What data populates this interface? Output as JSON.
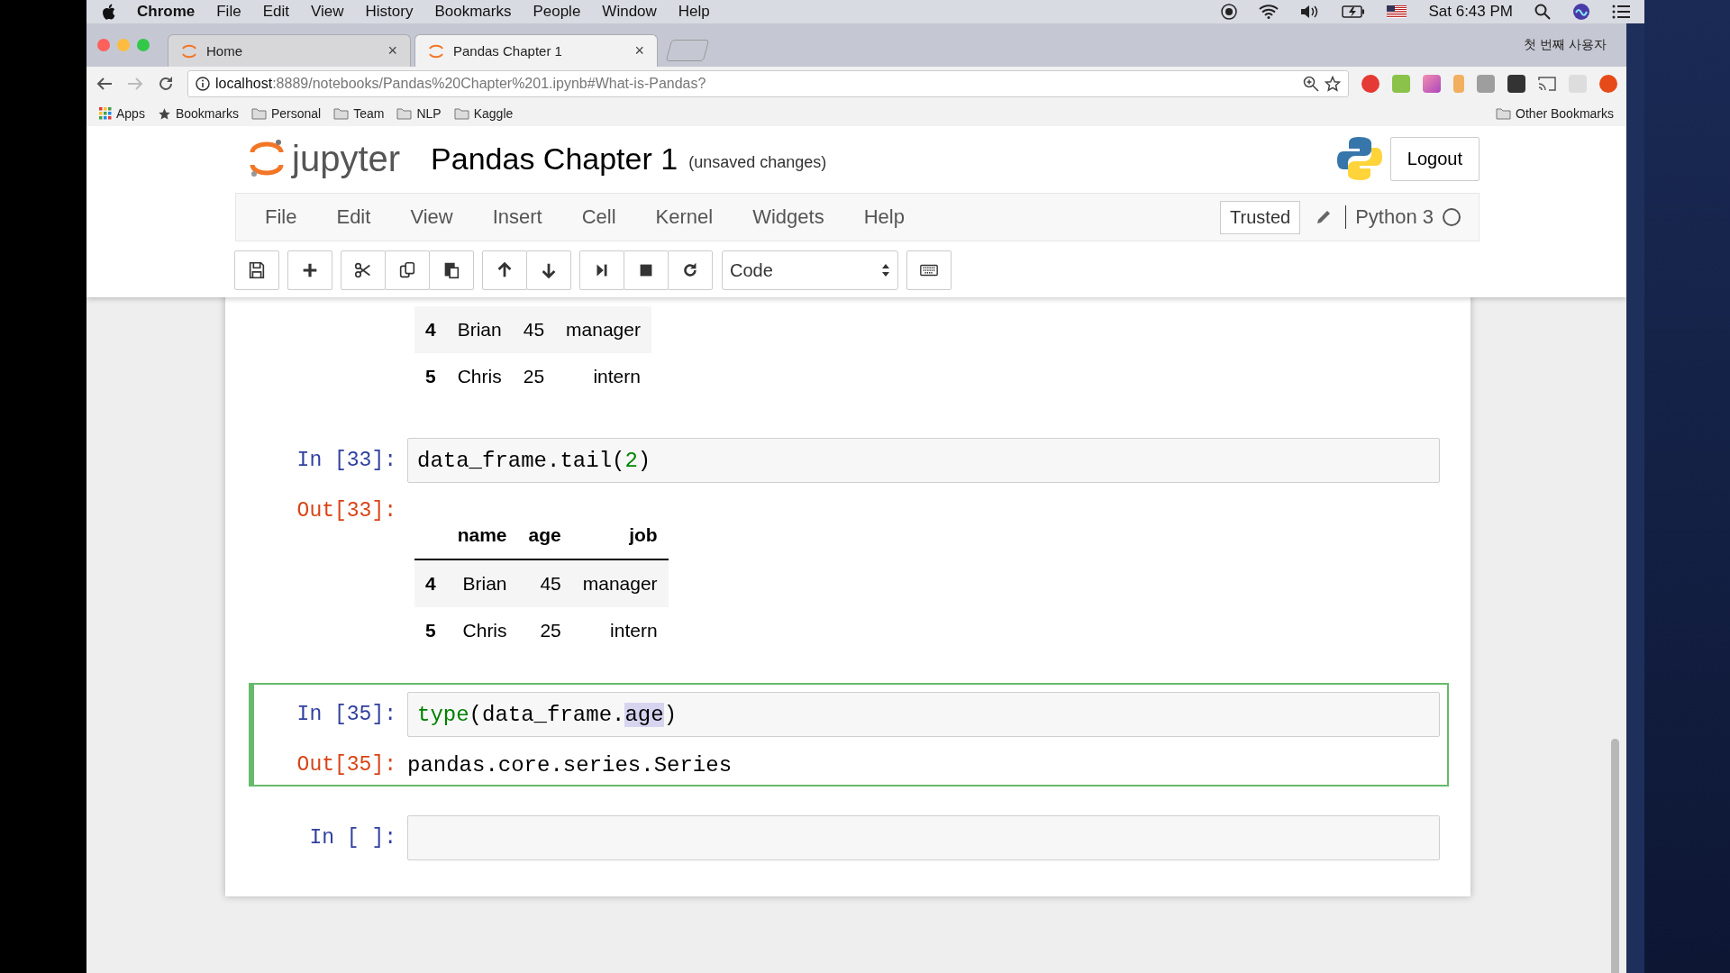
{
  "mac_menubar": {
    "app": "Chrome",
    "items": [
      "File",
      "Edit",
      "View",
      "History",
      "Bookmarks",
      "People",
      "Window",
      "Help"
    ],
    "clock": "Sat 6:43 PM"
  },
  "browser": {
    "tabs": [
      {
        "title": "Home",
        "selected": false,
        "close": "×"
      },
      {
        "title": "Pandas Chapter 1",
        "selected": true,
        "close": "×"
      }
    ],
    "profile": "첫 번째 사용자",
    "address": {
      "host": "localhost",
      "path": ":8889/notebooks/Pandas%20Chapter%201.ipynb#What-is-Pandas?"
    },
    "bookmarks": [
      {
        "label": "Apps",
        "kind": "apps"
      },
      {
        "label": "Bookmarks",
        "kind": "star"
      },
      {
        "label": "Personal",
        "kind": "folder"
      },
      {
        "label": "Team",
        "kind": "folder"
      },
      {
        "label": "NLP",
        "kind": "folder"
      },
      {
        "label": "Kaggle",
        "kind": "folder"
      }
    ],
    "other_bookmarks": "Other Bookmarks"
  },
  "notebook": {
    "logo": "jupyter",
    "title": "Pandas Chapter 1",
    "save_status": "(unsaved changes)",
    "logout": "Logout",
    "menu": [
      "File",
      "Edit",
      "View",
      "Insert",
      "Cell",
      "Kernel",
      "Widgets",
      "Help"
    ],
    "trusted": "Trusted",
    "kernel": "Python 3",
    "cell_type": "Code",
    "cells": [
      {
        "kind": "output",
        "table": {
          "rows": [
            [
              "4",
              "Brian",
              "45",
              "manager"
            ],
            [
              "5",
              "Chris",
              "25",
              "intern"
            ]
          ]
        }
      },
      {
        "kind": "code",
        "selected": false,
        "prompt": "In [33]:",
        "code": [
          {
            "text": "data_frame.tail(",
            "kind": "plain"
          },
          {
            "text": "2",
            "kind": "number"
          },
          {
            "text": ")",
            "kind": "plain"
          }
        ],
        "out_prompt": "Out[33]:",
        "table": {
          "columns": [
            "",
            "name",
            "age",
            "job"
          ],
          "rows": [
            [
              "4",
              "Brian",
              "45",
              "manager"
            ],
            [
              "5",
              "Chris",
              "25",
              "intern"
            ]
          ]
        }
      },
      {
        "kind": "code",
        "selected": true,
        "prompt": "In [35]:",
        "code": [
          {
            "text": "type",
            "kind": "builtin"
          },
          {
            "text": "(data_frame.",
            "kind": "plain"
          },
          {
            "text": "age",
            "kind": "highlight"
          },
          {
            "text": ")",
            "kind": "plain"
          }
        ],
        "out_prompt": "Out[35]:",
        "output": "pandas.core.series.Series"
      },
      {
        "kind": "code",
        "selected": false,
        "prompt": "In [ ]:"
      }
    ]
  }
}
